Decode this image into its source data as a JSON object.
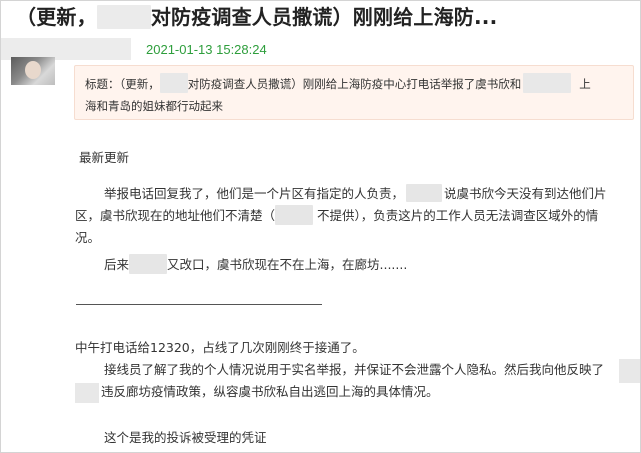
{
  "article": {
    "title_part1": "（更新，",
    "title_part2": "对防疫调查人员撒谎）刚刚给上海防...",
    "timestamp": "2021-01-13 15:28:24"
  },
  "quote": {
    "line1_a": "标题：（更新，",
    "line1_b": "对防疫调查人员撒谎）刚刚给上海防疫中心打电话举报了虞书欣和",
    "line1_c": "上",
    "line2": "海和青岛的姐妹都行动起来"
  },
  "body": {
    "section_title": "最新更新",
    "p1_a": "举报电话回复我了，他们是一个片区有指定的人负责，",
    "p1_b": "说虞书欣今天没有到达他们片",
    "p1_c": "区，虞书欣现在的地址他们不清楚（",
    "p1_d": "不提供），负责这片的工作人员无法调查区域外的情",
    "p1_e": "况。",
    "p2_a": "后来",
    "p2_b": "又改口，虞书欣现在不在上海，在廊坊.......",
    "p3": "中午打电话给12320，占线了几次刚刚终于接通了。",
    "p4_a": "接线员了解了我的个人情况说用于实名举报，并保证不会泄露个人隐私。然后我向他反映了",
    "p4_b": "违反廊坊疫情政策，纵容虞书欣私自出逃回上海的具体情况。",
    "p5": "这个是我的投诉被受理的凭证"
  }
}
